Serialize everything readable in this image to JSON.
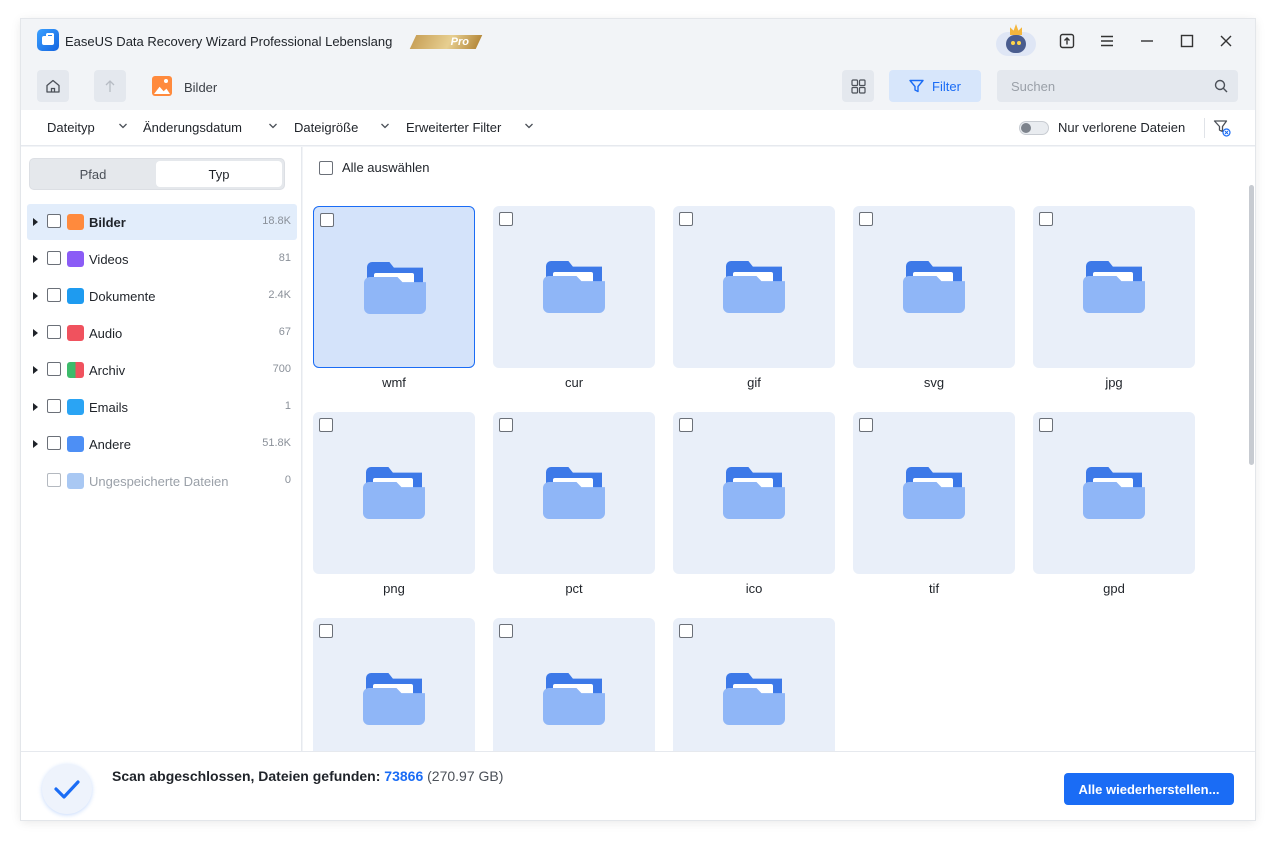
{
  "window": {
    "title": "EaseUS Data Recovery Wizard Professional Lebenslang",
    "badge": "Pro"
  },
  "toolbar": {
    "breadcrumb": "Bilder",
    "filter_label": "Filter",
    "search_placeholder": "Suchen"
  },
  "filters": {
    "items": [
      "Dateityp",
      "Änderungsdatum",
      "Dateigröße",
      "Erweiterter Filter"
    ],
    "lost_only_label": "Nur verlorene Dateien",
    "lost_only_enabled": false
  },
  "sidebar": {
    "tabs": [
      "Pfad",
      "Typ"
    ],
    "active_tab": "Typ",
    "types": [
      {
        "label": "Bilder",
        "count": "18.8K",
        "icon": "image-icon",
        "color": "#ff8a3d"
      },
      {
        "label": "Videos",
        "count": "81",
        "icon": "video-icon",
        "color": "#8b5cf6"
      },
      {
        "label": "Dokumente",
        "count": "2.4K",
        "icon": "document-icon",
        "color": "#1e9bf0"
      },
      {
        "label": "Audio",
        "count": "67",
        "icon": "audio-icon",
        "color": "#f0525e"
      },
      {
        "label": "Archiv",
        "count": "700",
        "icon": "archive-icon",
        "color": "#3dbb6b"
      },
      {
        "label": "Emails",
        "count": "1",
        "icon": "email-icon",
        "color": "#2aa4f4"
      },
      {
        "label": "Andere",
        "count": "51.8K",
        "icon": "other-icon",
        "color": "#4d8ff5"
      },
      {
        "label": "Ungespeicherte Dateien",
        "count": "0",
        "icon": "unsaved-icon",
        "color": "#a9c8f3"
      }
    ]
  },
  "main": {
    "select_all_label": "Alle auswählen",
    "folders": [
      "wmf",
      "cur",
      "gif",
      "svg",
      "jpg",
      "png",
      "pct",
      "ico",
      "tif",
      "gpd",
      "",
      "",
      ""
    ]
  },
  "footer": {
    "status_label": "Scan abgeschlossen, Dateien gefunden:",
    "file_count": "73866",
    "total_size": "(270.97 GB)",
    "recover_all_label": "Alle wiederherstellen..."
  },
  "colors": {
    "accent": "#1a6cf5",
    "tile_bg": "#e9eff9",
    "folder_back": "#3d79e8",
    "folder_front": "#8fb6f7"
  }
}
